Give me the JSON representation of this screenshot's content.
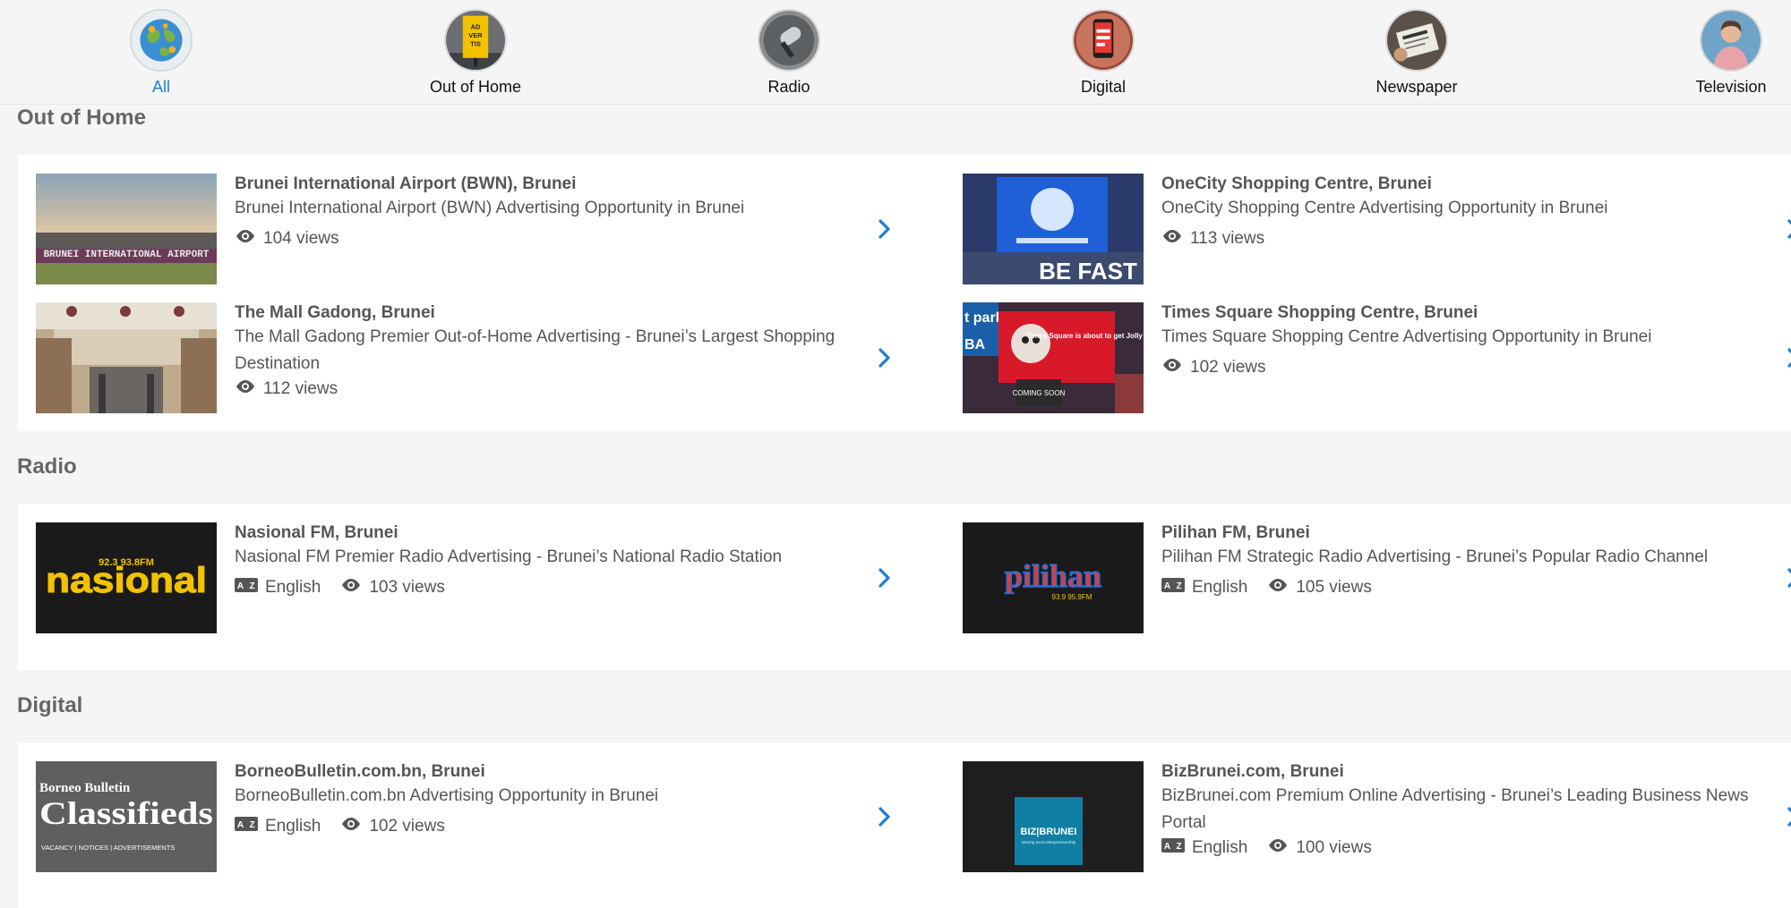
{
  "tabs": [
    {
      "label": "All",
      "icon": "globe-icon",
      "active": true
    },
    {
      "label": "Out of Home",
      "icon": "billboard-icon",
      "active": false
    },
    {
      "label": "Radio",
      "icon": "microphone-icon",
      "active": false
    },
    {
      "label": "Digital",
      "icon": "smartphone-icon",
      "active": false
    },
    {
      "label": "Newspaper",
      "icon": "newspaper-icon",
      "active": false
    },
    {
      "label": "Television",
      "icon": "presenter-icon",
      "active": false
    }
  ],
  "sections": [
    {
      "title": "Out of Home",
      "cards": [
        {
          "title": "Brunei International Airport (BWN), Brunei",
          "desc": "Brunei International Airport (BWN) Advertising Opportunity in Brunei",
          "views": "104 views"
        },
        {
          "title": "OneCity Shopping Centre, Brunei",
          "desc": "OneCity Shopping Centre Advertising Opportunity in Brunei",
          "views": "113 views"
        },
        {
          "title": "The Mall Gadong, Brunei",
          "desc": "The Mall Gadong Premier Out-of-Home Advertising - Brunei’s Largest Shopping Destination",
          "views": "112 views"
        },
        {
          "title": "Times Square Shopping Centre, Brunei",
          "desc": "Times Square Shopping Centre Advertising Opportunity in Brunei",
          "views": "102 views"
        }
      ]
    },
    {
      "title": "Radio",
      "cards": [
        {
          "title": "Nasional FM, Brunei",
          "desc": "Nasional FM Premier Radio Advertising - Brunei’s National Radio Station",
          "language": "English",
          "views": "103 views"
        },
        {
          "title": "Pilihan FM, Brunei",
          "desc": "Pilihan FM Strategic Radio Advertising - Brunei’s Popular Radio Channel",
          "language": "English",
          "views": "105 views"
        }
      ]
    },
    {
      "title": "Digital",
      "cards": [
        {
          "title": "BorneoBulletin.com.bn, Brunei",
          "desc": "BorneoBulletin.com.bn Advertising Opportunity in Brunei",
          "language": "English",
          "views": "102 views"
        },
        {
          "title": "BizBrunei.com, Brunei",
          "desc": "BizBrunei.com Premium Online Advertising - Brunei’s Leading Business News Portal",
          "language": "English",
          "views": "100 views"
        }
      ]
    }
  ],
  "thumb_text": {
    "airport": "BRUNEI INTERNATIONAL AIRPORT",
    "onecity": "BE FAST",
    "timessquare_park": "t park",
    "timessquare_ba": "BA",
    "timessquare_sign": "Times Square is about to get Jolly",
    "timessquare_soon": "COMING SOON",
    "nasional_freq": "92.3 93.8FM",
    "nasional": "nasional",
    "pilihan": "pilihan",
    "pilihan_freq": "93.9 95.9FM",
    "borneo_title": "Borneo Bulletin",
    "borneo_main": "Classifieds",
    "borneo_sub": "VACANCY | NOTICES | ADVERTISEMENTS",
    "biz": "BIZ|BRUNEI",
    "biz_tag": "Moving local entrepreneurship"
  },
  "colors": {
    "accent": "#1a7fd4",
    "text": "#555555",
    "heading": "#666666",
    "background": "#f5f5f5"
  }
}
